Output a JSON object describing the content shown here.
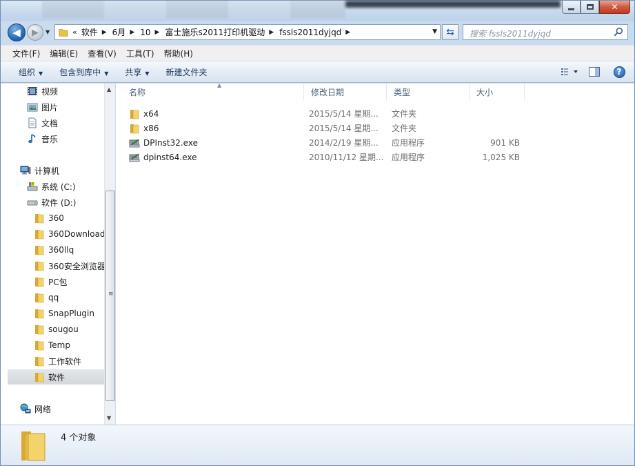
{
  "address": {
    "overflow": "«",
    "crumbs": [
      "软件",
      "6月",
      "10",
      "富士施乐s2011打印机驱动",
      "fssls2011dyjqd"
    ]
  },
  "search": {
    "placeholder": "搜索 fssls2011dyjqd"
  },
  "menu": [
    "文件(F)",
    "编辑(E)",
    "查看(V)",
    "工具(T)",
    "帮助(H)"
  ],
  "toolbar": {
    "organize": "组织",
    "include": "包含到库中",
    "share": "共享",
    "new_folder": "新建文件夹"
  },
  "nav": {
    "libraries": [
      "视频",
      "图片",
      "文档",
      "音乐"
    ],
    "computer": "计算机",
    "drives": [
      "系统 (C:)",
      "软件 (D:)"
    ],
    "folders": [
      "360",
      "360Download",
      "360llq",
      "360安全浏览器",
      "PC包",
      "qq",
      "SnapPlugin",
      "sougou",
      "Temp",
      "工作软件",
      "软件"
    ],
    "selected_folder": "软件",
    "network": "网络"
  },
  "columns": {
    "name": "名称",
    "date": "修改日期",
    "type": "类型",
    "size": "大小"
  },
  "files": [
    {
      "name": "x64",
      "date": "2015/5/14 星期...",
      "type": "文件夹",
      "size": "",
      "icon": "folder-icon"
    },
    {
      "name": "x86",
      "date": "2015/5/14 星期...",
      "type": "文件夹",
      "size": "",
      "icon": "folder-icon"
    },
    {
      "name": "DPInst32.exe",
      "date": "2014/2/19 星期...",
      "type": "应用程序",
      "size": "901 KB",
      "icon": "installer-icon"
    },
    {
      "name": "dpinst64.exe",
      "date": "2010/11/12 星期...",
      "type": "应用程序",
      "size": "1,025 KB",
      "icon": "installer-icon"
    }
  ],
  "details": {
    "count_text": "4 个对象"
  },
  "colors": {
    "accent": "#1f5fb0",
    "folder": "#e9c24a",
    "selection": "#d8dbe0"
  }
}
